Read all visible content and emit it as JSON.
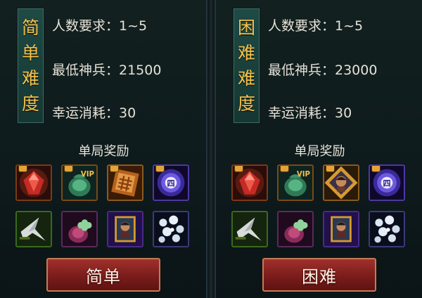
{
  "panels": [
    {
      "difficulty_chars": [
        "简",
        "单",
        "难",
        "度"
      ],
      "players_label": "人数要求：1~5",
      "weapon_label": "最低神兵：21500",
      "luck_label": "幸运消耗：30",
      "reward_title": "单局奖励",
      "rewards": [
        "red-gem-icon",
        "vip-pouch-icon",
        "bronze-chest-icon",
        "purple-orb-icon",
        "arrowhead-icon",
        "clover-pouch-icon",
        "portrait-card-icon",
        "pearls-icon"
      ],
      "button_label": "简单"
    },
    {
      "difficulty_chars": [
        "困",
        "难",
        "难",
        "度"
      ],
      "players_label": "人数要求：1~5",
      "weapon_label": "最低神兵：23000",
      "luck_label": "幸运消耗：30",
      "reward_title": "单局奖励",
      "rewards": [
        "red-gem-icon",
        "vip-pouch-icon",
        "hero-portrait-icon",
        "purple-orb-icon",
        "arrowhead-icon",
        "clover-pouch-icon",
        "portrait-card-icon",
        "pearls-icon"
      ],
      "button_label": "困难"
    }
  ],
  "orb_glyph": "四",
  "vip_text": "VIP",
  "colors": {
    "title_gold": "#f3c14a",
    "button_red": "#8a2420",
    "panel_bg": "#12201f"
  }
}
